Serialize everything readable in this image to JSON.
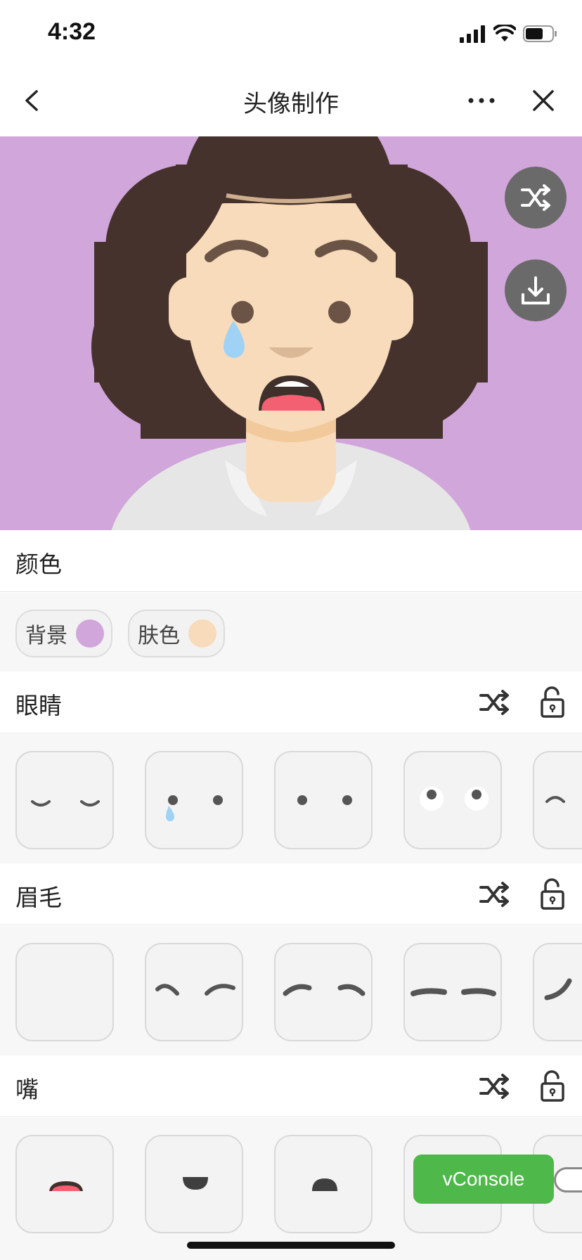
{
  "status": {
    "time": "4:32"
  },
  "nav": {
    "title": "头像制作"
  },
  "colors": {
    "avatar_background": "#d1a6da",
    "skin": "#f8dbbb",
    "hair": "#45322d",
    "fab": "#6a6a6a",
    "vconsole": "#4fb84a"
  },
  "sections": {
    "color": {
      "title": "颜色",
      "chips": [
        {
          "label": "背景",
          "swatch": "#d1a6da"
        },
        {
          "label": "肤色",
          "swatch": "#f8dbbb"
        }
      ]
    },
    "eyes": {
      "title": "眼睛",
      "options": [
        "closed-eyes",
        "teary-eyes",
        "dot-eyes",
        "round-white-eyes",
        "arched-eye"
      ]
    },
    "eyebrows": {
      "title": "眉毛",
      "options": [
        "none",
        "wavy-brows",
        "arched-brows",
        "flat-brows",
        "curved-brow"
      ]
    },
    "mouth": {
      "title": "嘴",
      "options": [
        "open-mouth-red",
        "half-moon-down",
        "half-moon-up",
        "hidden",
        "hidden"
      ]
    }
  },
  "vconsole": {
    "label": "vConsole"
  }
}
